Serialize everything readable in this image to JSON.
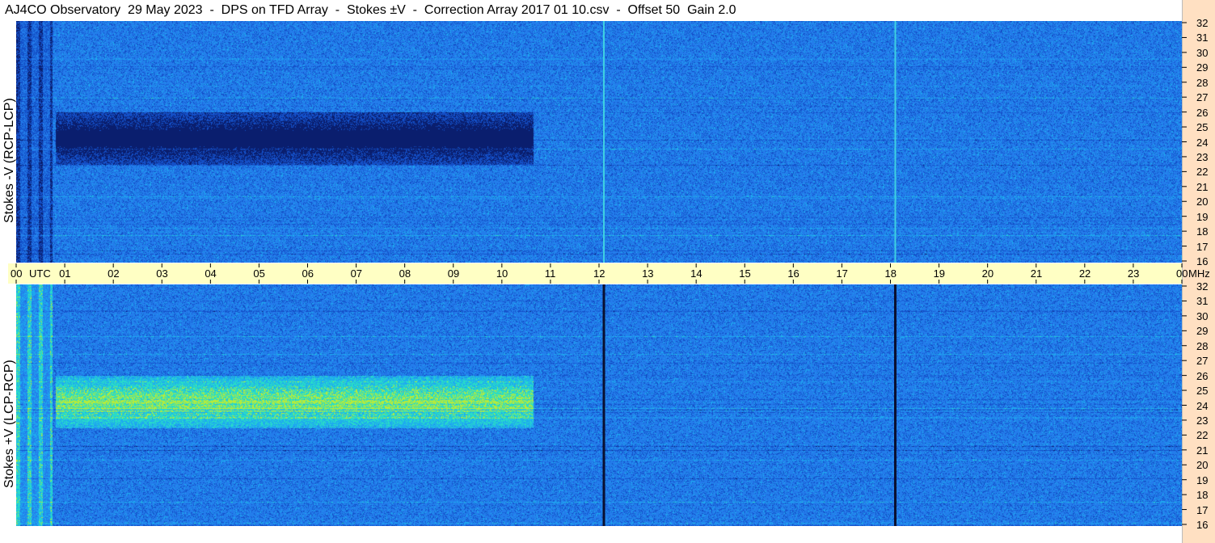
{
  "title": "AJ4CO Observatory  29 May 2023  -  DPS on TFD Array  -  Stokes ±V  -  Correction Array 2017 01 10.csv  -  Offset 50  Gain 2.0",
  "chart_data": {
    "type": "heatmap",
    "title": "AJ4CO Observatory  29 May 2023  -  DPS on TFD Array  -  Stokes ±V  -  Correction Array 2017 01 10.csv  -  Offset 50  Gain 2.0",
    "panels": [
      {
        "ylabel": "Stokes -V (RCP-LCP)",
        "ylim": [
          16,
          32
        ],
        "palette": "dark"
      },
      {
        "ylabel": "Stokes +V (LCP-RCP)",
        "ylim": [
          16,
          32
        ],
        "palette": "light"
      }
    ],
    "x_axis": {
      "unit_label": "UTC",
      "xlim": [
        0,
        24
      ],
      "tick_labels": [
        "00",
        "01",
        "02",
        "03",
        "04",
        "05",
        "06",
        "07",
        "08",
        "09",
        "10",
        "11",
        "12",
        "13",
        "14",
        "15",
        "16",
        "17",
        "18",
        "19",
        "20",
        "21",
        "22",
        "23",
        "00"
      ]
    },
    "y_axis": {
      "unit_label": "MHz",
      "tick_labels": [
        "32",
        "31",
        "30",
        "29",
        "28",
        "27",
        "26",
        "25",
        "24",
        "23",
        "22",
        "21",
        "20",
        "19",
        "18",
        "17",
        "16"
      ]
    },
    "features": {
      "vertical_lines_utc": [
        12.1,
        18.1
      ],
      "enhanced_block_utc": [
        0.8,
        10.65
      ],
      "enhanced_block_mhz": [
        22.5,
        26.0
      ]
    }
  }
}
